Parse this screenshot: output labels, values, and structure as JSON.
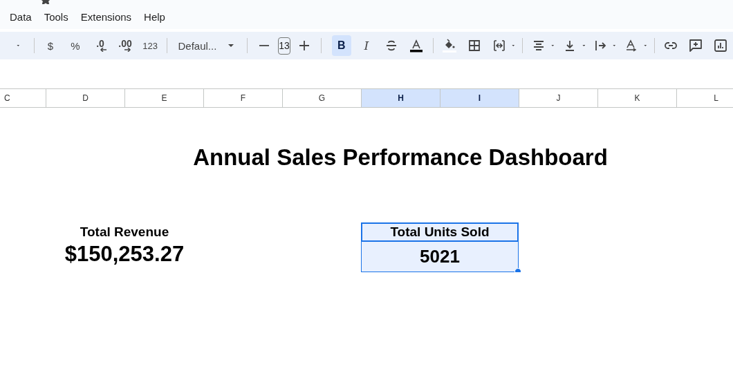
{
  "menu": [
    "Data",
    "Tools",
    "Extensions",
    "Help"
  ],
  "toolbar": {
    "currency": "$",
    "percent": "%",
    "decrease_decimals": ".0",
    "increase_decimals": ".00",
    "number_format": "123",
    "font": "Defaul...",
    "font_size": "13",
    "bold": {
      "label": "B",
      "selected": true
    },
    "italic": {
      "label": "I",
      "selected": false
    }
  },
  "columns": [
    {
      "label": "C",
      "selected": false
    },
    {
      "label": "D",
      "selected": false
    },
    {
      "label": "E",
      "selected": false
    },
    {
      "label": "F",
      "selected": false
    },
    {
      "label": "G",
      "selected": false
    },
    {
      "label": "H",
      "selected": true
    },
    {
      "label": "I",
      "selected": true
    },
    {
      "label": "J",
      "selected": false
    },
    {
      "label": "K",
      "selected": false
    },
    {
      "label": "L",
      "selected": false
    }
  ],
  "sheet": {
    "title": "Annual Sales Performance Dashboard",
    "metrics": [
      {
        "label": "Total Revenue",
        "value": "$150,253.27",
        "selected": false
      },
      {
        "label": "Total Units Sold",
        "value": "5021",
        "selected": true
      }
    ]
  }
}
